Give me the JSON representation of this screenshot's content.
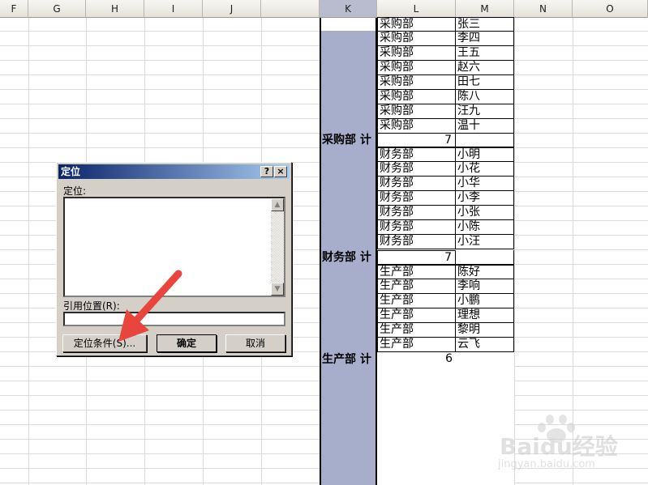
{
  "columns": [
    "F",
    "G",
    "H",
    "I",
    "J",
    "K",
    "L",
    "M",
    "N",
    "O"
  ],
  "purchasing_rows": [
    {
      "dept": "采购部",
      "name": "张三"
    },
    {
      "dept": "采购部",
      "name": "李四"
    },
    {
      "dept": "采购部",
      "name": "王五"
    },
    {
      "dept": "采购部",
      "name": "赵六"
    },
    {
      "dept": "采购部",
      "name": "田七"
    },
    {
      "dept": "采购部",
      "name": "陈八"
    },
    {
      "dept": "采购部",
      "name": "汪九"
    },
    {
      "dept": "采购部",
      "name": "温十"
    }
  ],
  "purchasing_subtotal": {
    "label": "采购部 计",
    "count": "7"
  },
  "finance_rows": [
    {
      "dept": "财务部",
      "name": "小明"
    },
    {
      "dept": "财务部",
      "name": "小花"
    },
    {
      "dept": "财务部",
      "name": "小华"
    },
    {
      "dept": "财务部",
      "name": "小李"
    },
    {
      "dept": "财务部",
      "name": "小张"
    },
    {
      "dept": "财务部",
      "name": "小陈"
    },
    {
      "dept": "财务部",
      "name": "小汪"
    }
  ],
  "finance_subtotal": {
    "label": "财务部 计",
    "count": "7"
  },
  "production_rows": [
    {
      "dept": "生产部",
      "name": "陈好"
    },
    {
      "dept": "生产部",
      "name": "李响"
    },
    {
      "dept": "生产部",
      "name": "小鹏"
    },
    {
      "dept": "生产部",
      "name": "理想"
    },
    {
      "dept": "生产部",
      "name": "黎明"
    },
    {
      "dept": "生产部",
      "name": "云飞"
    }
  ],
  "production_subtotal": {
    "label": "生产部 计",
    "count": "6"
  },
  "dialog": {
    "title": "定位",
    "help_button": "?",
    "close_button": "×",
    "goto_label": "定位:",
    "reference_label": "引用位置(R):",
    "special_button": "定位条件(S)...",
    "ok_button": "确定",
    "cancel_button": "取消"
  },
  "watermark": {
    "brand": "Baidu经验",
    "url": "jingyan.baidu.com"
  },
  "colors": {
    "selection": "#a7aecb",
    "arrow": "#e8453c",
    "title_bar": "#0a246a"
  }
}
